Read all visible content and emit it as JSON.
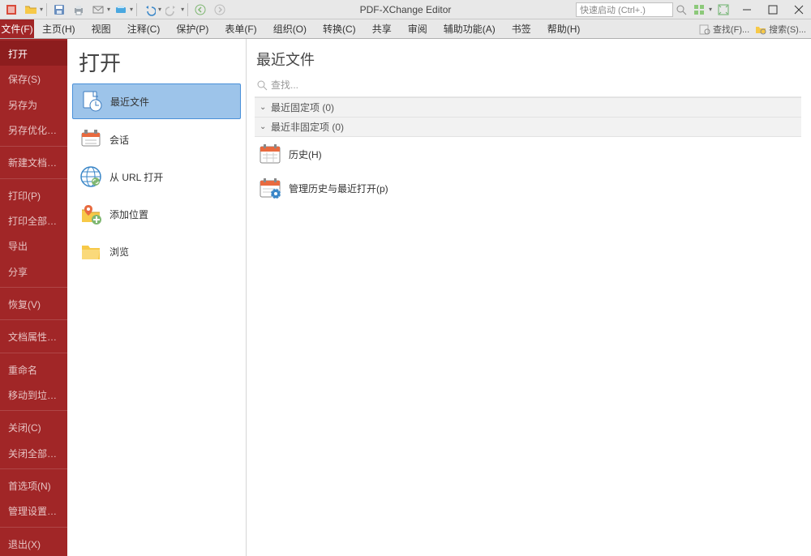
{
  "app": {
    "title": "PDF-XChange Editor"
  },
  "quick_launch": {
    "placeholder": "快速启动 (Ctrl+.)"
  },
  "ribbon": {
    "file_tab": "文件(F)",
    "tabs": [
      "主页(H)",
      "视图",
      "注释(C)",
      "保护(P)",
      "表单(F)",
      "组织(O)",
      "转换(C)",
      "共享",
      "审阅",
      "辅助功能(A)",
      "书签",
      "帮助(H)"
    ],
    "find": "查找(F)...",
    "search": "搜索(S)..."
  },
  "sidebar": {
    "items": [
      {
        "label": "打开",
        "active": true
      },
      {
        "label": "保存(S)"
      },
      {
        "label": "另存为"
      },
      {
        "label": "另存优化的副本"
      }
    ],
    "group2": [
      {
        "label": "新建文档(N)"
      }
    ],
    "group3": [
      {
        "label": "打印(P)"
      },
      {
        "label": "打印全部(R)"
      },
      {
        "label": "导出"
      },
      {
        "label": "分享"
      }
    ],
    "group4": [
      {
        "label": "恢复(V)"
      }
    ],
    "group5": [
      {
        "label": "文档属性(D)"
      }
    ],
    "group6": [
      {
        "label": "重命名"
      },
      {
        "label": "移动到垃圾箱"
      }
    ],
    "group7": [
      {
        "label": "关闭(C)"
      },
      {
        "label": "关闭全部(S)"
      }
    ],
    "group8": [
      {
        "label": "首选项(N)"
      },
      {
        "label": "管理设置(M)"
      }
    ],
    "group9": [
      {
        "label": "退出(X)"
      }
    ]
  },
  "open": {
    "title": "打开",
    "items": [
      {
        "label": "最近文件",
        "icon": "recent",
        "selected": true
      },
      {
        "label": "会话",
        "icon": "sessions"
      },
      {
        "label": "从 URL 打开",
        "icon": "url"
      },
      {
        "label": "添加位置",
        "icon": "addplace"
      },
      {
        "label": "浏览",
        "icon": "browse"
      }
    ]
  },
  "recent": {
    "title": "最近文件",
    "search_placeholder": "查找...",
    "group_pinned": "最近固定项 (0)",
    "group_unpinned": "最近非固定项 (0)",
    "history": "历史(H)",
    "manage": "管理历史与最近打开(p)"
  }
}
